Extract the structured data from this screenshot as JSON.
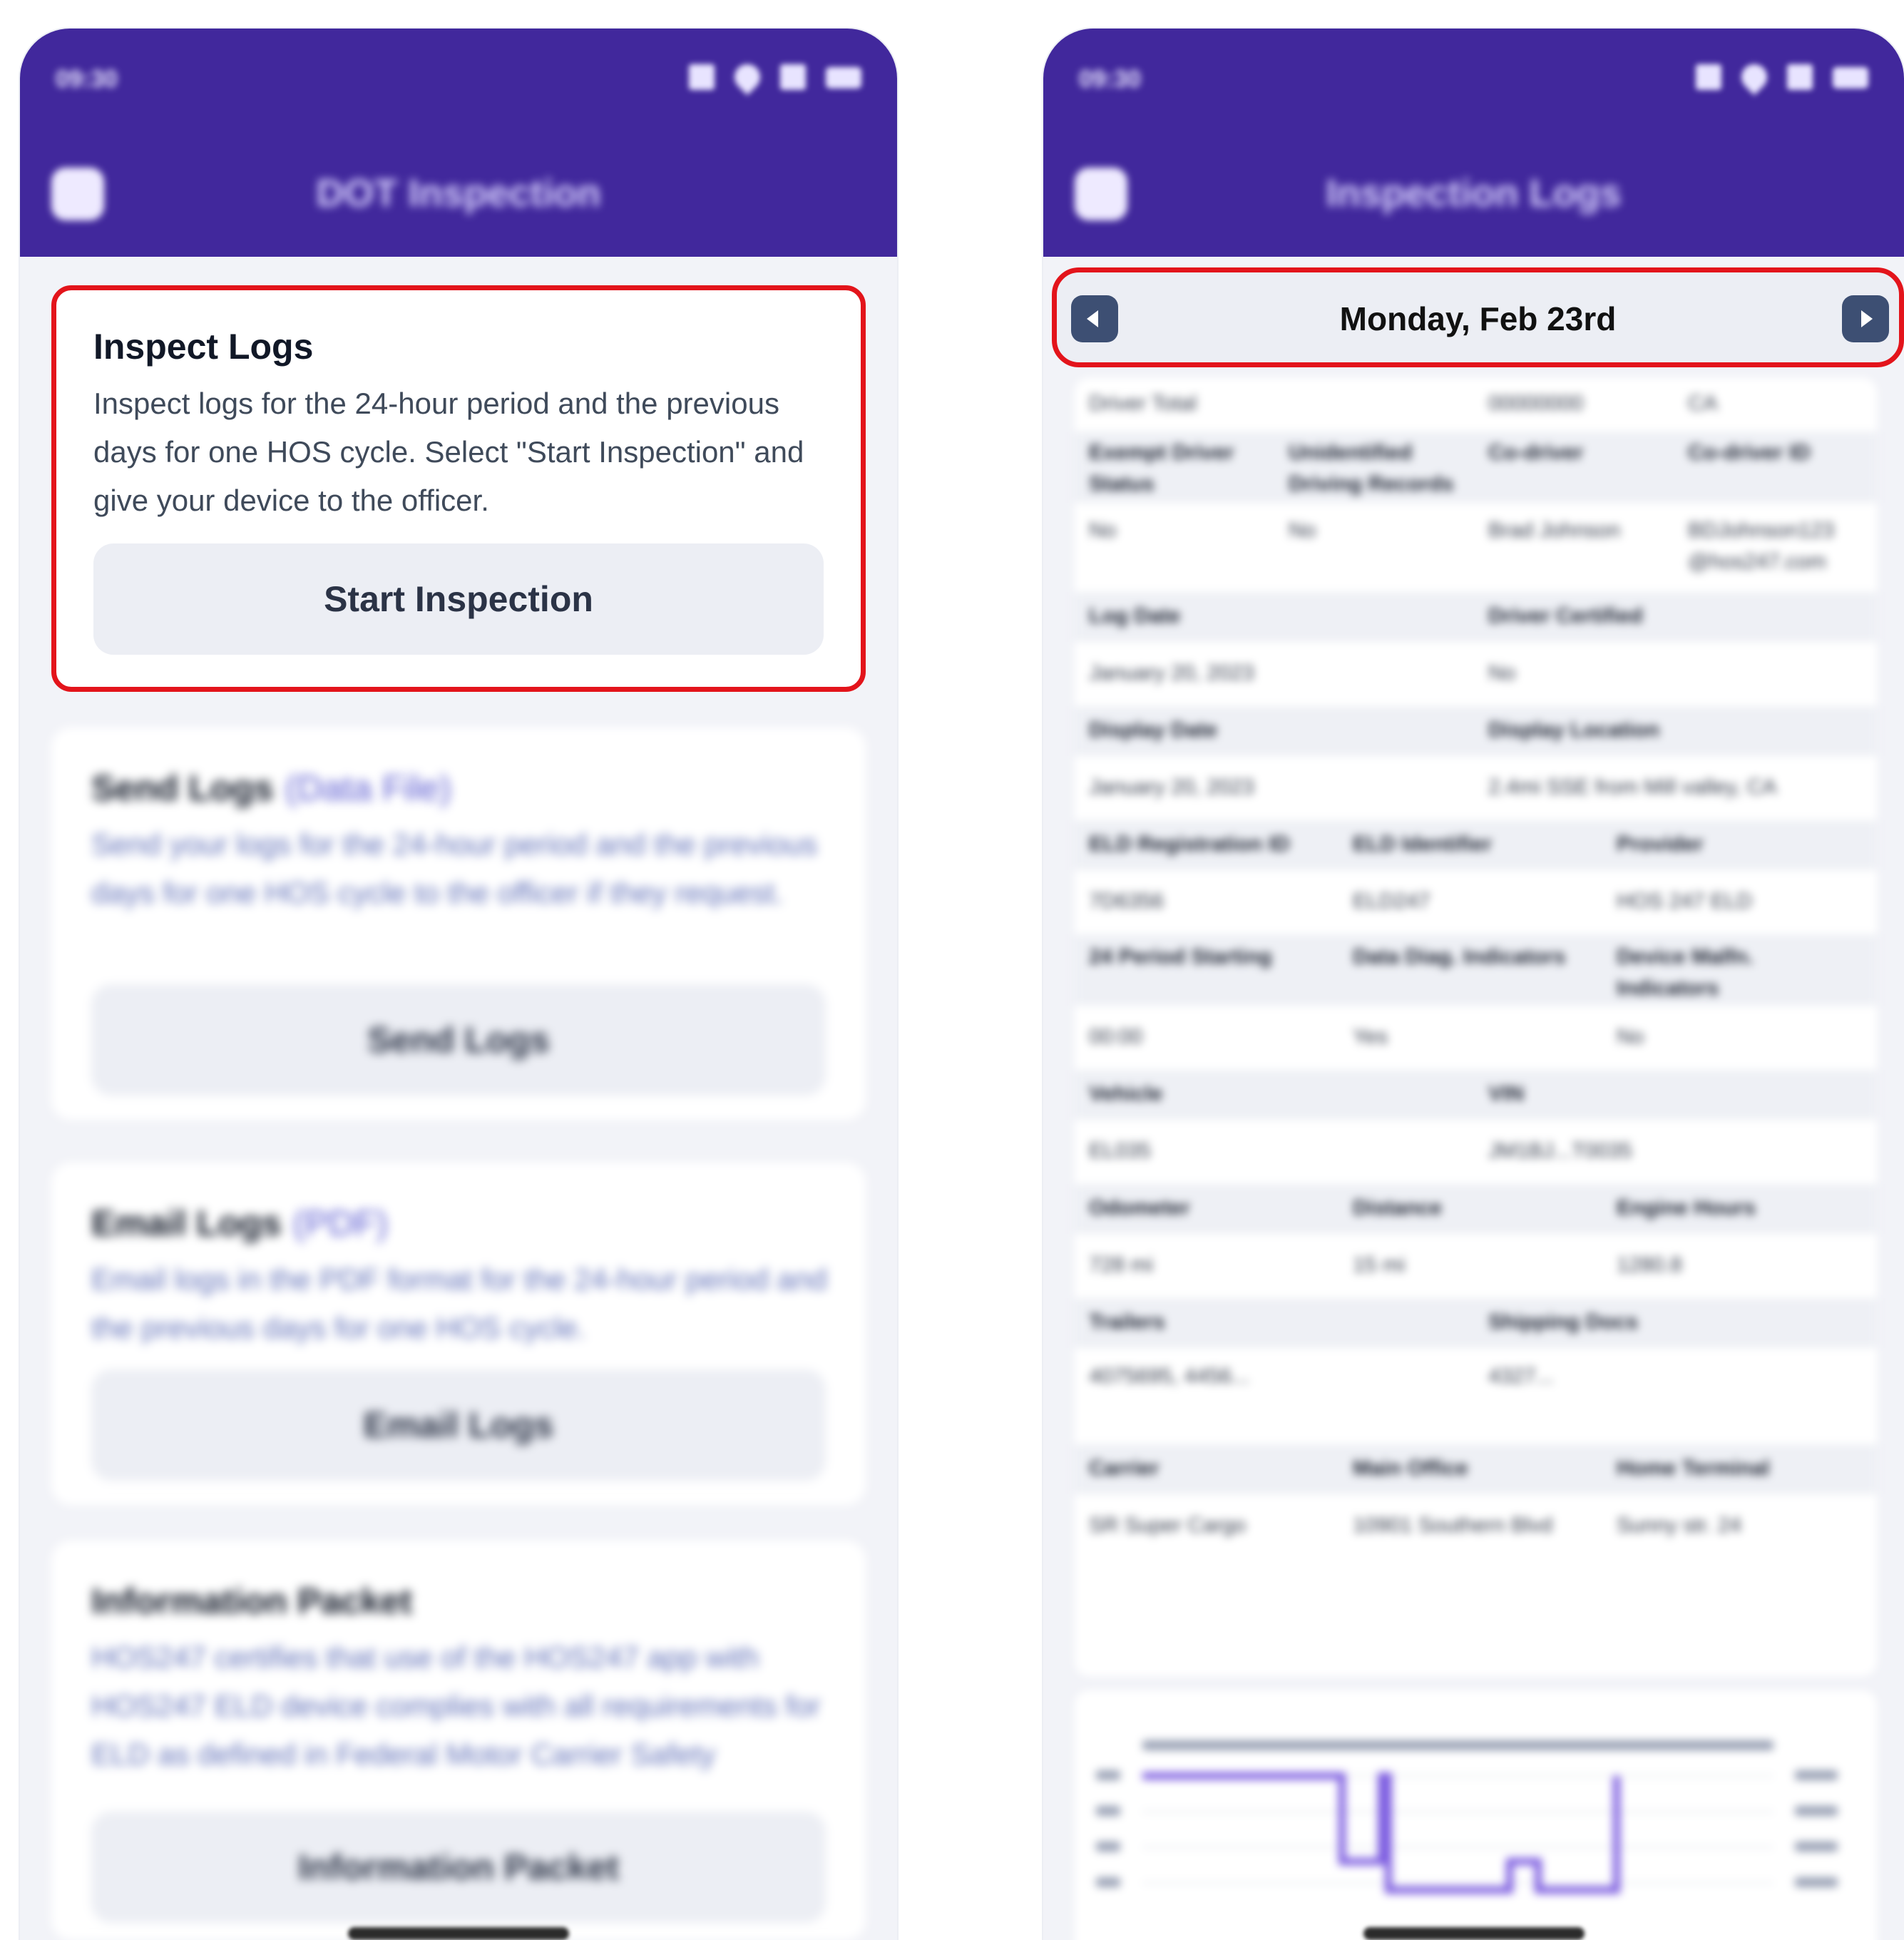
{
  "left_screen": {
    "inspect_card": {
      "title": "Inspect Logs",
      "description": "Inspect logs for the 24-hour period and the previous days for one HOS cycle. Select \"Start Inspection\" and give your device to the officer.",
      "button_label": "Start Inspection"
    }
  },
  "right_screen": {
    "date_label": "Monday, Feb 23rd"
  },
  "colors": {
    "app_bar": "#41289c",
    "highlight": "#e3141b",
    "nav_button": "#3d4f73",
    "graph_line": "#7c5ce0"
  },
  "icons": [
    "menu-icon",
    "back-icon",
    "chevron-left-icon",
    "chevron-right-icon",
    "wifi-icon",
    "signal-icon",
    "battery-icon"
  ]
}
